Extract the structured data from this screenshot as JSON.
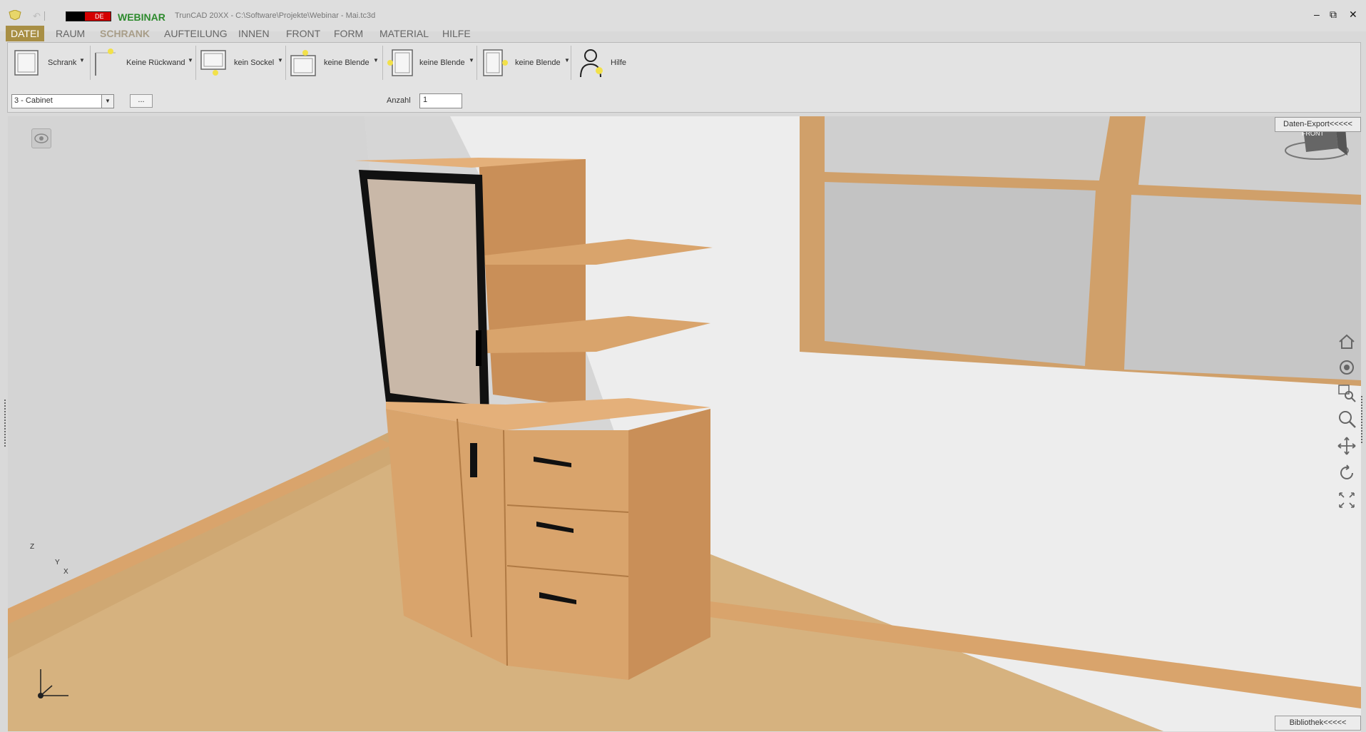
{
  "titlebar": {
    "lang_flag_text": "DE",
    "webinar_label": "WEBINAR",
    "window_title": "TrunCAD 20XX - C:\\Software\\Projekte\\Webinar - Mai.tc3d",
    "minimize": "–",
    "restore": "⧉",
    "close": "✕"
  },
  "menu": {
    "items": [
      "DATEI",
      "RAUM",
      "SCHRANK",
      "AUFTEILUNG",
      "INNEN",
      "FRONT",
      "FORM",
      "MATERIAL",
      "HILFE"
    ],
    "active": "DATEI"
  },
  "ribbon": {
    "buttons": [
      {
        "label": "Schrank",
        "icon": "cabinet-icon"
      },
      {
        "label": "Keine Rückwand",
        "icon": "back-panel-icon"
      },
      {
        "label": "kein Sockel",
        "icon": "plinth-icon"
      },
      {
        "label": "keine Blende",
        "icon": "top-panel-icon"
      },
      {
        "label": "keine Blende",
        "icon": "left-panel-icon"
      },
      {
        "label": "keine Blende",
        "icon": "right-panel-icon"
      },
      {
        "label": "Hilfe",
        "icon": "help-person-icon"
      }
    ],
    "dropdown_arrow": "▼",
    "cabinet_select": "3 - Cabinet",
    "more_button": "...",
    "anzahl_label": "Anzahl",
    "anzahl_value": "1"
  },
  "viewport": {
    "export_tab": "Daten-Export<<<<<",
    "library_tab": "Bibliothek<<<<<",
    "view_cube_label": "FRONT",
    "axis_labels": {
      "z": "Z",
      "y": "Y",
      "x": "X"
    },
    "nav_tools": [
      "home-icon",
      "orbit-icon",
      "zoom-window-icon",
      "zoom-icon",
      "pan-icon",
      "rotate-icon",
      "fit-icon"
    ]
  },
  "colors": {
    "accent": "#a88f45",
    "webinar": "#2d8a2d",
    "wood": "#d9a46c",
    "wood_dark": "#b07a44",
    "floor": "#d6b27f",
    "wall": "#efefef"
  }
}
